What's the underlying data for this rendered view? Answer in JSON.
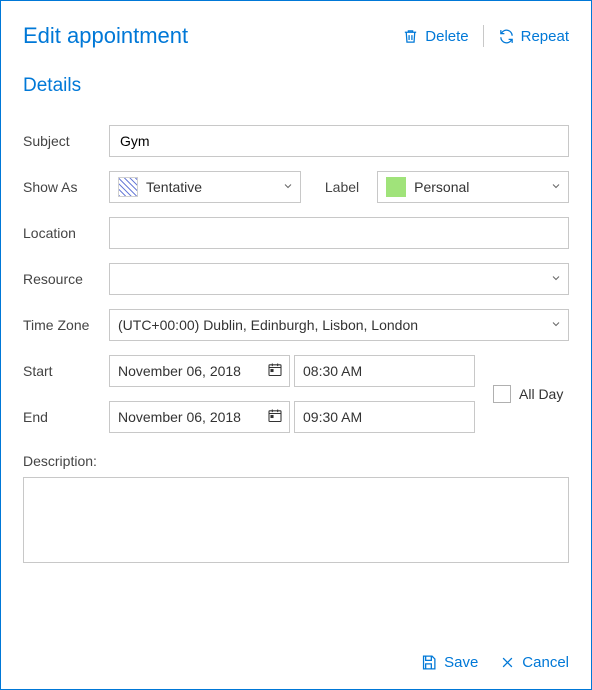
{
  "header": {
    "title": "Edit appointment",
    "delete": "Delete",
    "repeat": "Repeat"
  },
  "section": "Details",
  "labels": {
    "subject": "Subject",
    "showAs": "Show As",
    "labelField": "Label",
    "location": "Location",
    "resource": "Resource",
    "timezone": "Time Zone",
    "start": "Start",
    "end": "End",
    "allDay": "All Day",
    "description": "Description:"
  },
  "values": {
    "subject": "Gym",
    "showAs": "Tentative",
    "labelVal": "Personal",
    "location": "",
    "resource": "",
    "timezone": "(UTC+00:00) Dublin, Edinburgh, Lisbon, London",
    "startDate": "November 06, 2018",
    "startTime": "08:30 AM",
    "endDate": "November 06, 2018",
    "endTime": "09:30 AM",
    "description": ""
  },
  "colors": {
    "accent": "#0078d7",
    "labelSwatch": "#a0e37a"
  },
  "footer": {
    "save": "Save",
    "cancel": "Cancel"
  }
}
